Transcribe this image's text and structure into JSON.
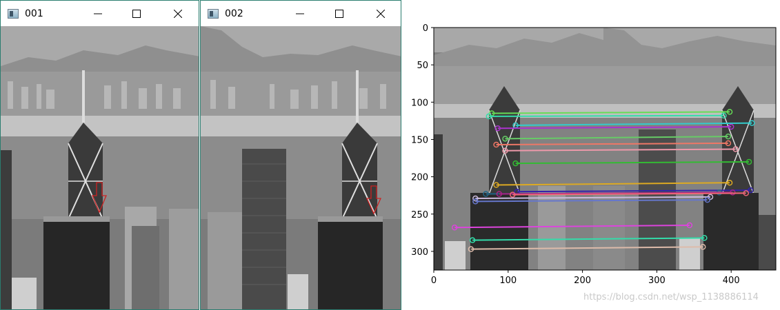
{
  "windows": [
    {
      "title": "001",
      "icon": "app-window-icon"
    },
    {
      "title": "002",
      "icon": "app-window-icon"
    }
  ],
  "titlebar_buttons": [
    "minimize-icon",
    "maximize-icon",
    "close-icon"
  ],
  "plot": {
    "x_ticks": [
      "0",
      "100",
      "200",
      "300",
      "400"
    ],
    "y_ticks": [
      "0",
      "50",
      "100",
      "150",
      "200",
      "250",
      "300"
    ]
  },
  "chart_data": {
    "type": "scatter",
    "description_axes": "matplotlib image axes",
    "xlim": [
      0,
      460
    ],
    "ylim": [
      325,
      0
    ],
    "matches": [
      {
        "x1": 78,
        "y1": 115,
        "x2": 398,
        "y2": 113,
        "color": "#66dd55"
      },
      {
        "x1": 74,
        "y1": 119,
        "x2": 390,
        "y2": 118,
        "color": "#33ddaa"
      },
      {
        "x1": 110,
        "y1": 131,
        "x2": 428,
        "y2": 128,
        "color": "#33cccc"
      },
      {
        "x1": 86,
        "y1": 135,
        "x2": 400,
        "y2": 133,
        "color": "#aa33cc"
      },
      {
        "x1": 96,
        "y1": 149,
        "x2": 396,
        "y2": 146,
        "color": "#66cc66"
      },
      {
        "x1": 84,
        "y1": 157,
        "x2": 396,
        "y2": 155,
        "color": "#ee7766"
      },
      {
        "x1": 96,
        "y1": 165,
        "x2": 406,
        "y2": 163,
        "color": "#ee99aa"
      },
      {
        "x1": 110,
        "y1": 182,
        "x2": 424,
        "y2": 180,
        "color": "#33bb33"
      },
      {
        "x1": 84,
        "y1": 211,
        "x2": 398,
        "y2": 208,
        "color": "#ddaa22"
      },
      {
        "x1": 112,
        "y1": 220,
        "x2": 426,
        "y2": 218,
        "color": "#3322aa"
      },
      {
        "x1": 70,
        "y1": 223,
        "x2": 384,
        "y2": 221,
        "color": "#226688"
      },
      {
        "x1": 88,
        "y1": 223,
        "x2": 402,
        "y2": 221,
        "color": "#aa2288"
      },
      {
        "x1": 106,
        "y1": 224,
        "x2": 420,
        "y2": 222,
        "color": "#ee6677"
      },
      {
        "x1": 56,
        "y1": 229,
        "x2": 372,
        "y2": 227,
        "color": "#ccbbdd"
      },
      {
        "x1": 56,
        "y1": 233,
        "x2": 368,
        "y2": 231,
        "color": "#6677cc"
      },
      {
        "x1": 28,
        "y1": 268,
        "x2": 344,
        "y2": 265,
        "color": "#dd44dd"
      },
      {
        "x1": 52,
        "y1": 285,
        "x2": 364,
        "y2": 282,
        "color": "#33ddaa"
      },
      {
        "x1": 50,
        "y1": 297,
        "x2": 362,
        "y2": 294,
        "color": "#ddbbaa"
      }
    ]
  },
  "watermark": "https://blog.csdn.net/wsp_1138886114"
}
